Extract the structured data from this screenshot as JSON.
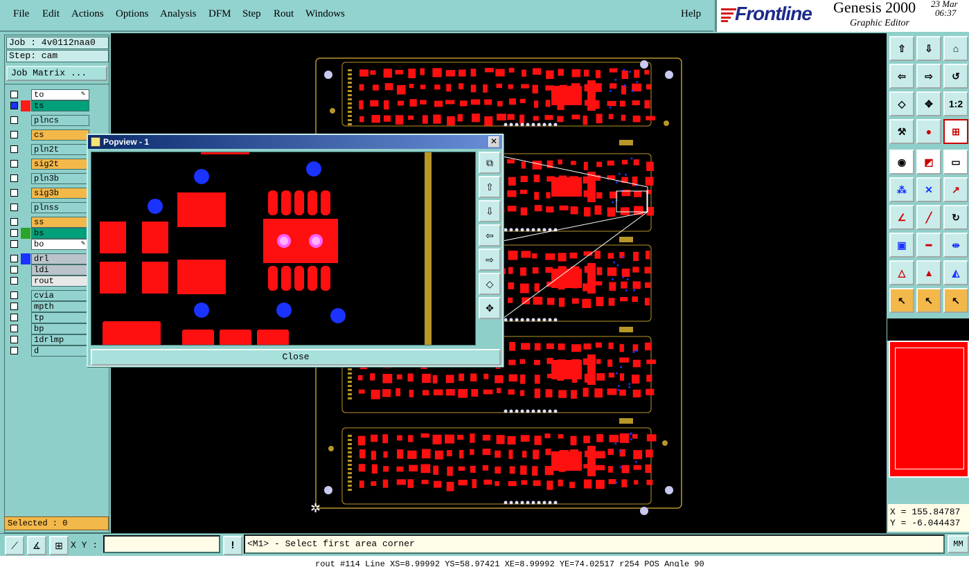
{
  "menu": {
    "file": "File",
    "edit": "Edit",
    "actions": "Actions",
    "options": "Options",
    "analysis": "Analysis",
    "dfm": "DFM",
    "step": "Step",
    "rout": "Rout",
    "windows": "Windows",
    "help": "Help"
  },
  "brand": {
    "logo": "Frontline",
    "product": "Genesis 2000",
    "subtitle": "Graphic Editor",
    "date": "23 Mar",
    "time": "06:37"
  },
  "job": {
    "job_label": "Job : 4v0112naa0",
    "step_label": "Step: cam",
    "matrix_button": "Job Matrix ..."
  },
  "layers": [
    {
      "name": "to",
      "color": "#ffffff",
      "swatch": "#000000",
      "state": "edit"
    },
    {
      "name": "ts",
      "color": "#00a07a",
      "swatch": "#ff1a1a",
      "state": "active"
    },
    {
      "name": "plncs",
      "color": "#93d3cf",
      "swatch": "#000000",
      "state": ""
    },
    {
      "name": "cs",
      "color": "#f3b84a",
      "swatch": "#000000",
      "state": ""
    },
    {
      "name": "pln2t",
      "color": "#93d3cf",
      "swatch": "#000000",
      "state": ""
    },
    {
      "name": "sig2t",
      "color": "#f3b84a",
      "swatch": "#000000",
      "state": ""
    },
    {
      "name": "pln3b",
      "color": "#93d3cf",
      "swatch": "#000000",
      "state": ""
    },
    {
      "name": "sig3b",
      "color": "#f3b84a",
      "swatch": "#000000",
      "state": ""
    },
    {
      "name": "plnss",
      "color": "#93d3cf",
      "swatch": "#000000",
      "state": ""
    },
    {
      "name": "ss",
      "color": "#f3b84a",
      "swatch": "#000000",
      "state": ""
    },
    {
      "name": "bs",
      "color": "#00a07a",
      "swatch": "#2aa52a",
      "state": ""
    },
    {
      "name": "bo",
      "color": "#ffffff",
      "swatch": "#000000",
      "state": "edit"
    },
    {
      "name": "drl",
      "color": "#b9c3c9",
      "swatch": "#1a33ff",
      "state": ""
    },
    {
      "name": "ldi",
      "color": "#b9c3c9",
      "swatch": "#000000",
      "state": ""
    },
    {
      "name": "rout",
      "color": "#e8e8e8",
      "swatch": "#000000",
      "state": ""
    },
    {
      "name": "cvia",
      "color": "#93d3cf",
      "swatch": "#000000",
      "state": ""
    },
    {
      "name": "mpth",
      "color": "#93d3cf",
      "swatch": "#000000",
      "state": ""
    },
    {
      "name": "tp",
      "color": "#93d3cf",
      "swatch": "#000000",
      "state": ""
    },
    {
      "name": "bp",
      "color": "#93d3cf",
      "swatch": "#000000",
      "state": ""
    },
    {
      "name": "1drlmp",
      "color": "#93d3cf",
      "swatch": "#000000",
      "state": ""
    },
    {
      "name": "d",
      "color": "#93d3cf",
      "swatch": "#000000",
      "state": ""
    }
  ],
  "selected": "Selected : 0",
  "popview": {
    "title": "Popview - 1",
    "close_label": "Close"
  },
  "coords": {
    "x": "X = 155.84787",
    "y": "Y = -6.044437"
  },
  "bottom": {
    "xy_label": "X Y :",
    "xy_value": "",
    "prompt": "<M1> - Select first area corner",
    "units": "MM"
  },
  "status_line": "rout #114 Line XS=8.99992 YS=58.97421 XE=8.99992 YE=74.02517 r254 POS Angle 90",
  "toolbar_zoom_label": "1:2"
}
